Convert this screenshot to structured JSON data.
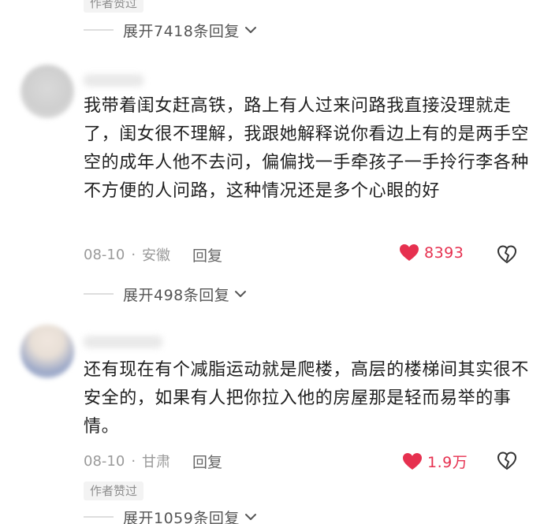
{
  "top": {
    "author_badge": "作者赞过",
    "expand_text": "展开7418条回复"
  },
  "comments": [
    {
      "text": "我带着闺女赶高铁，路上有人过来问路我直接没理就走了，闺女很不理解，我跟她解释说你看边上有的是两手空空的成年人他不去问，偏偏找一手牵孩子一手拎行李各种不方便的人问路，这种情况还是多个心眼的好",
      "date": "08-10",
      "dot": "·",
      "location": "安徽",
      "reply_label": "回复",
      "likes": "8393",
      "expand_text": "展开498条回复"
    },
    {
      "text": "还有现在有个减脂运动就是爬楼，高层的楼梯间其实很不安全的，如果有人把你拉入他的房屋那是轻而易举的事情。",
      "date": "08-10",
      "dot": "·",
      "location": "甘肃",
      "reply_label": "回复",
      "likes": "1.9万",
      "author_badge": "作者赞过",
      "expand_text": "展开1059条回复"
    }
  ],
  "colors": {
    "like": "#e6304f",
    "meta": "#9a9a9a",
    "text": "#1f1f1f"
  },
  "icons": [
    "heart-icon",
    "broken-heart-icon",
    "chevron-down-icon"
  ]
}
